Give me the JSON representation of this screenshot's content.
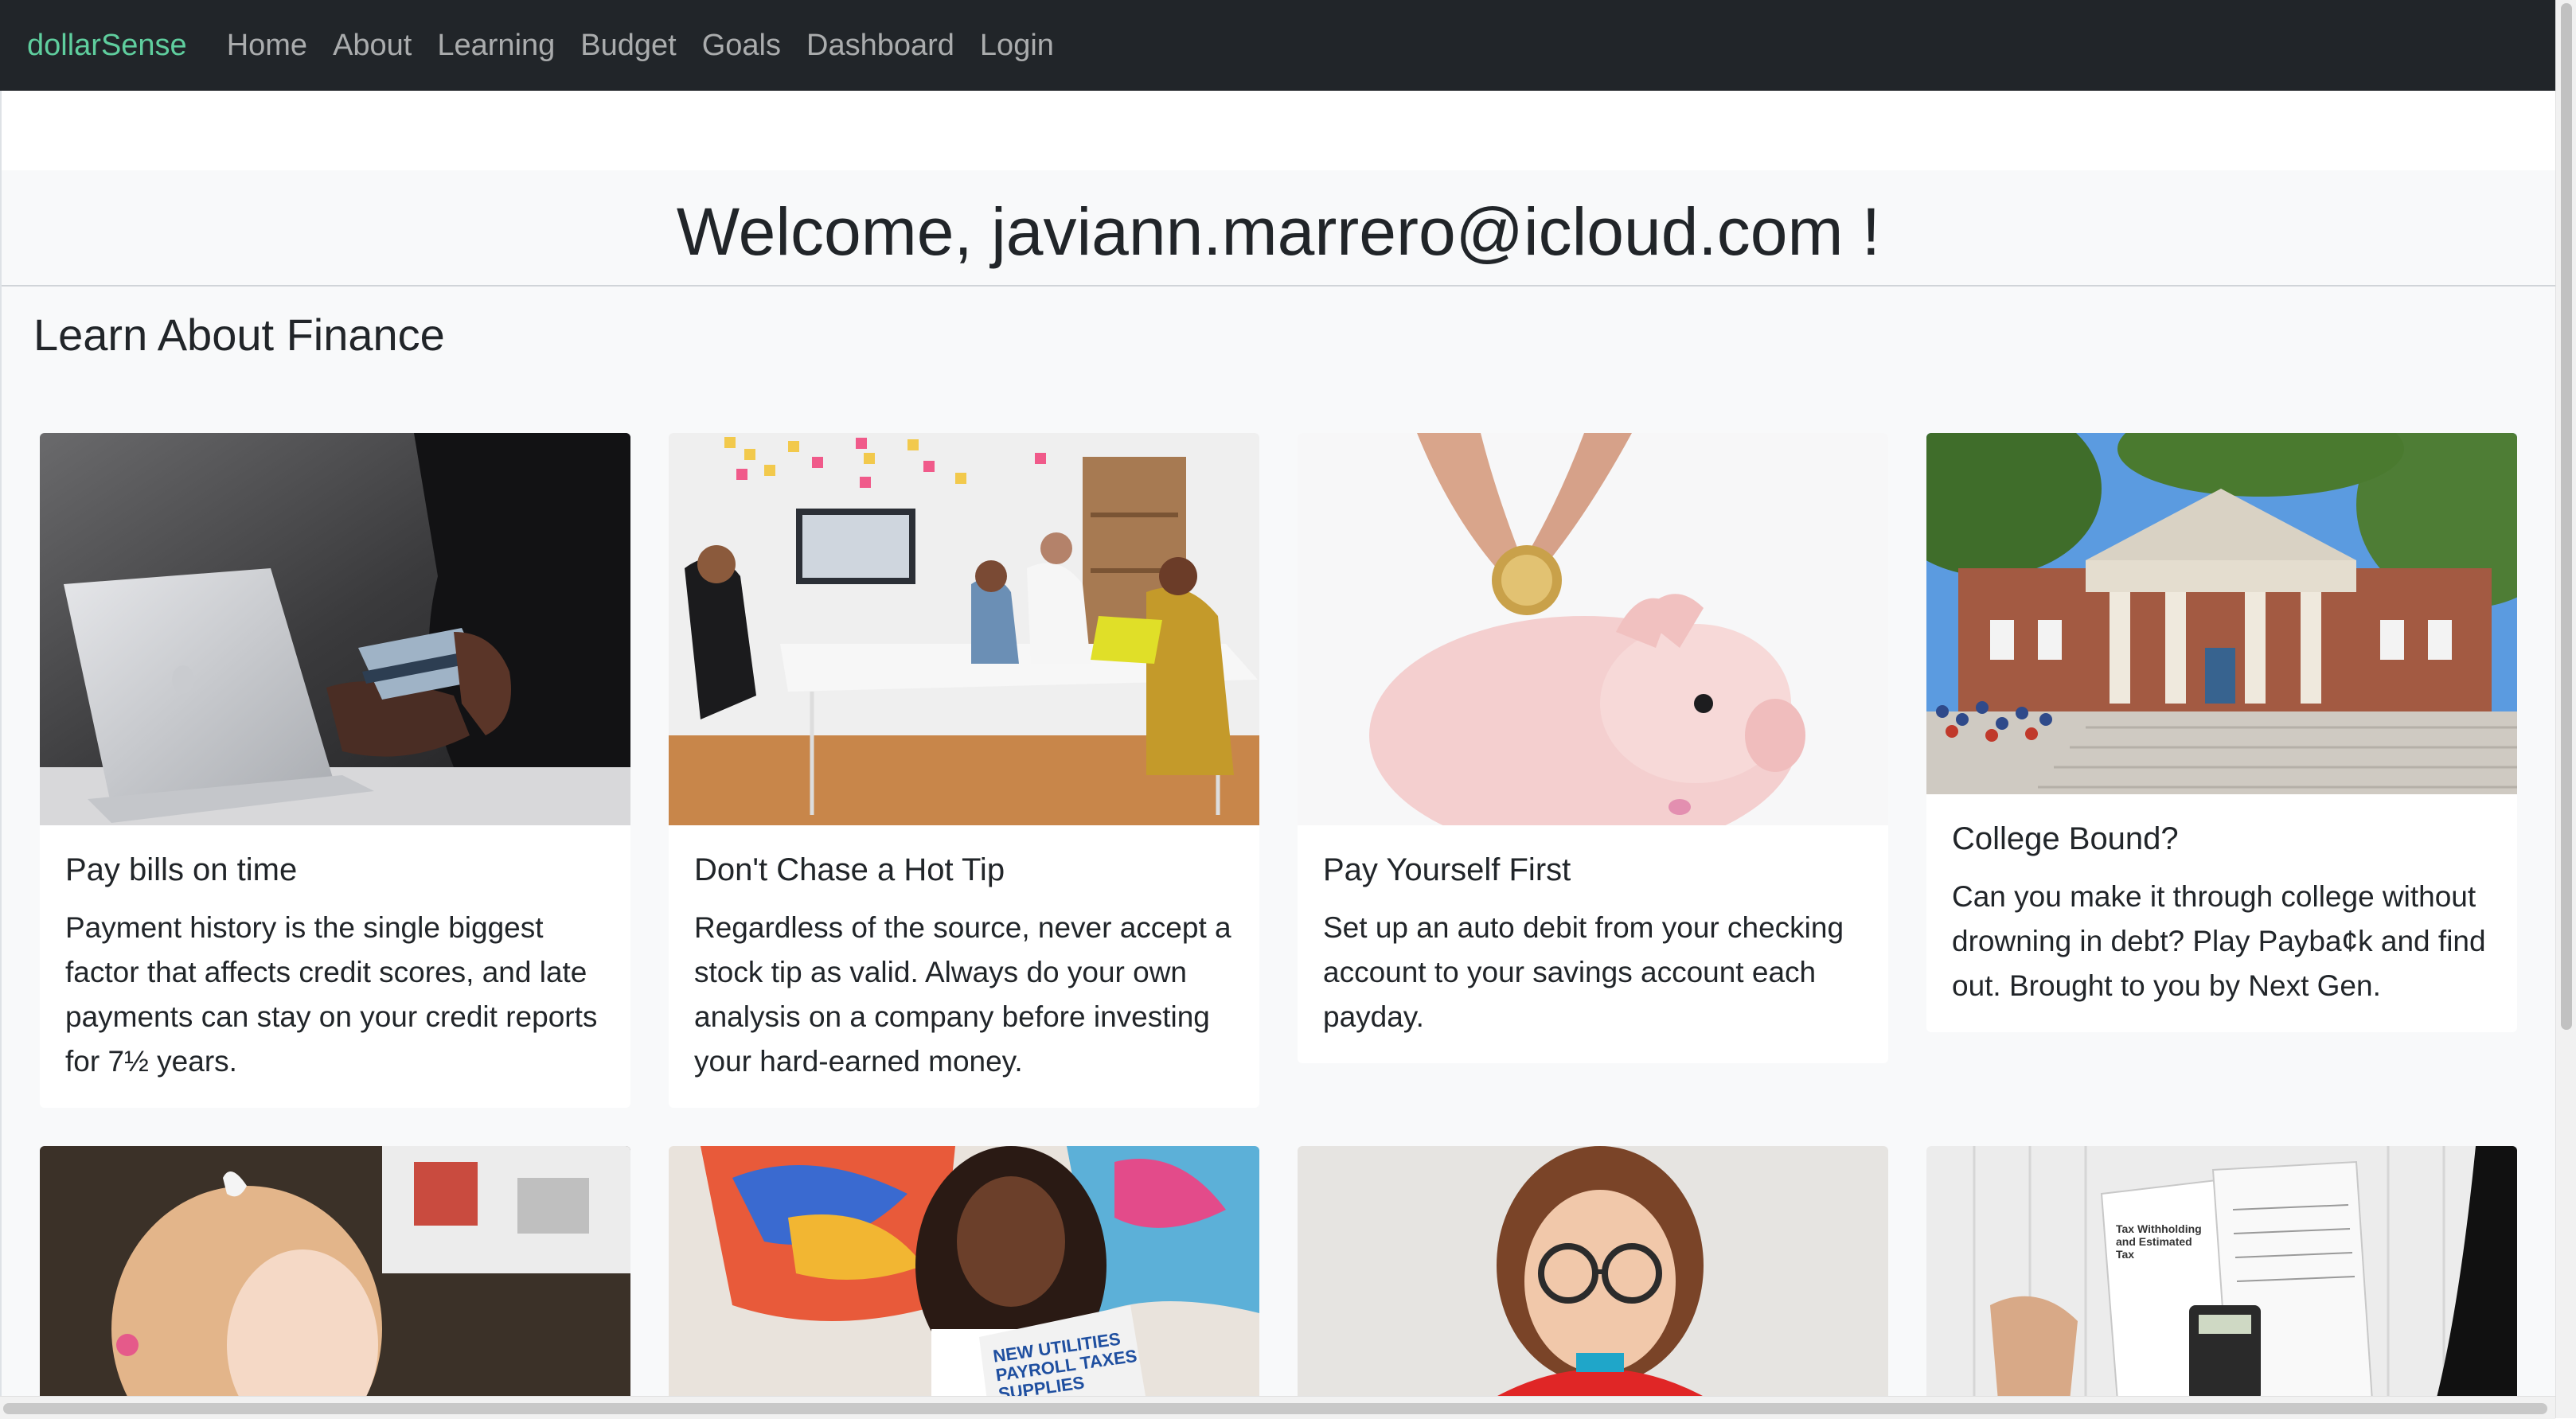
{
  "navbar": {
    "brand": "dollarSense",
    "links": [
      "Home",
      "About",
      "Learning",
      "Budget",
      "Goals",
      "Dashboard",
      "Login"
    ]
  },
  "welcome": "Welcome, javiann.marrero@icloud.com !",
  "section_title": "Learn About Finance",
  "cards": [
    {
      "title": "Pay bills on time",
      "text": "Payment history is the single biggest factor that affects credit scores, and late payments can stay on your credit reports for 7½ years."
    },
    {
      "title": "Don't Chase a Hot Tip",
      "text": "Regardless of the source, never accept a stock tip as valid. Always do your own analysis on a company before investing your hard-earned money."
    },
    {
      "title": "Pay Yourself First",
      "text": "Set up an auto debit from your checking account to your savings account each payday."
    },
    {
      "title": "College Bound?",
      "text": "Can you make it through college without drowning in debt? Play Payba¢k and find out. Brought to you by Next Gen."
    }
  ],
  "photo_text": {
    "book_cover": "NEW UTILITIES PAYROLL TAXES SUPPLIES",
    "tax_form": "Tax Withholding and Estimated Tax"
  },
  "colors": {
    "navbar_bg": "#212529",
    "brand": "#5fce9e",
    "nav_link": "#a6a8aa",
    "section_bg": "#f8f9fa"
  }
}
